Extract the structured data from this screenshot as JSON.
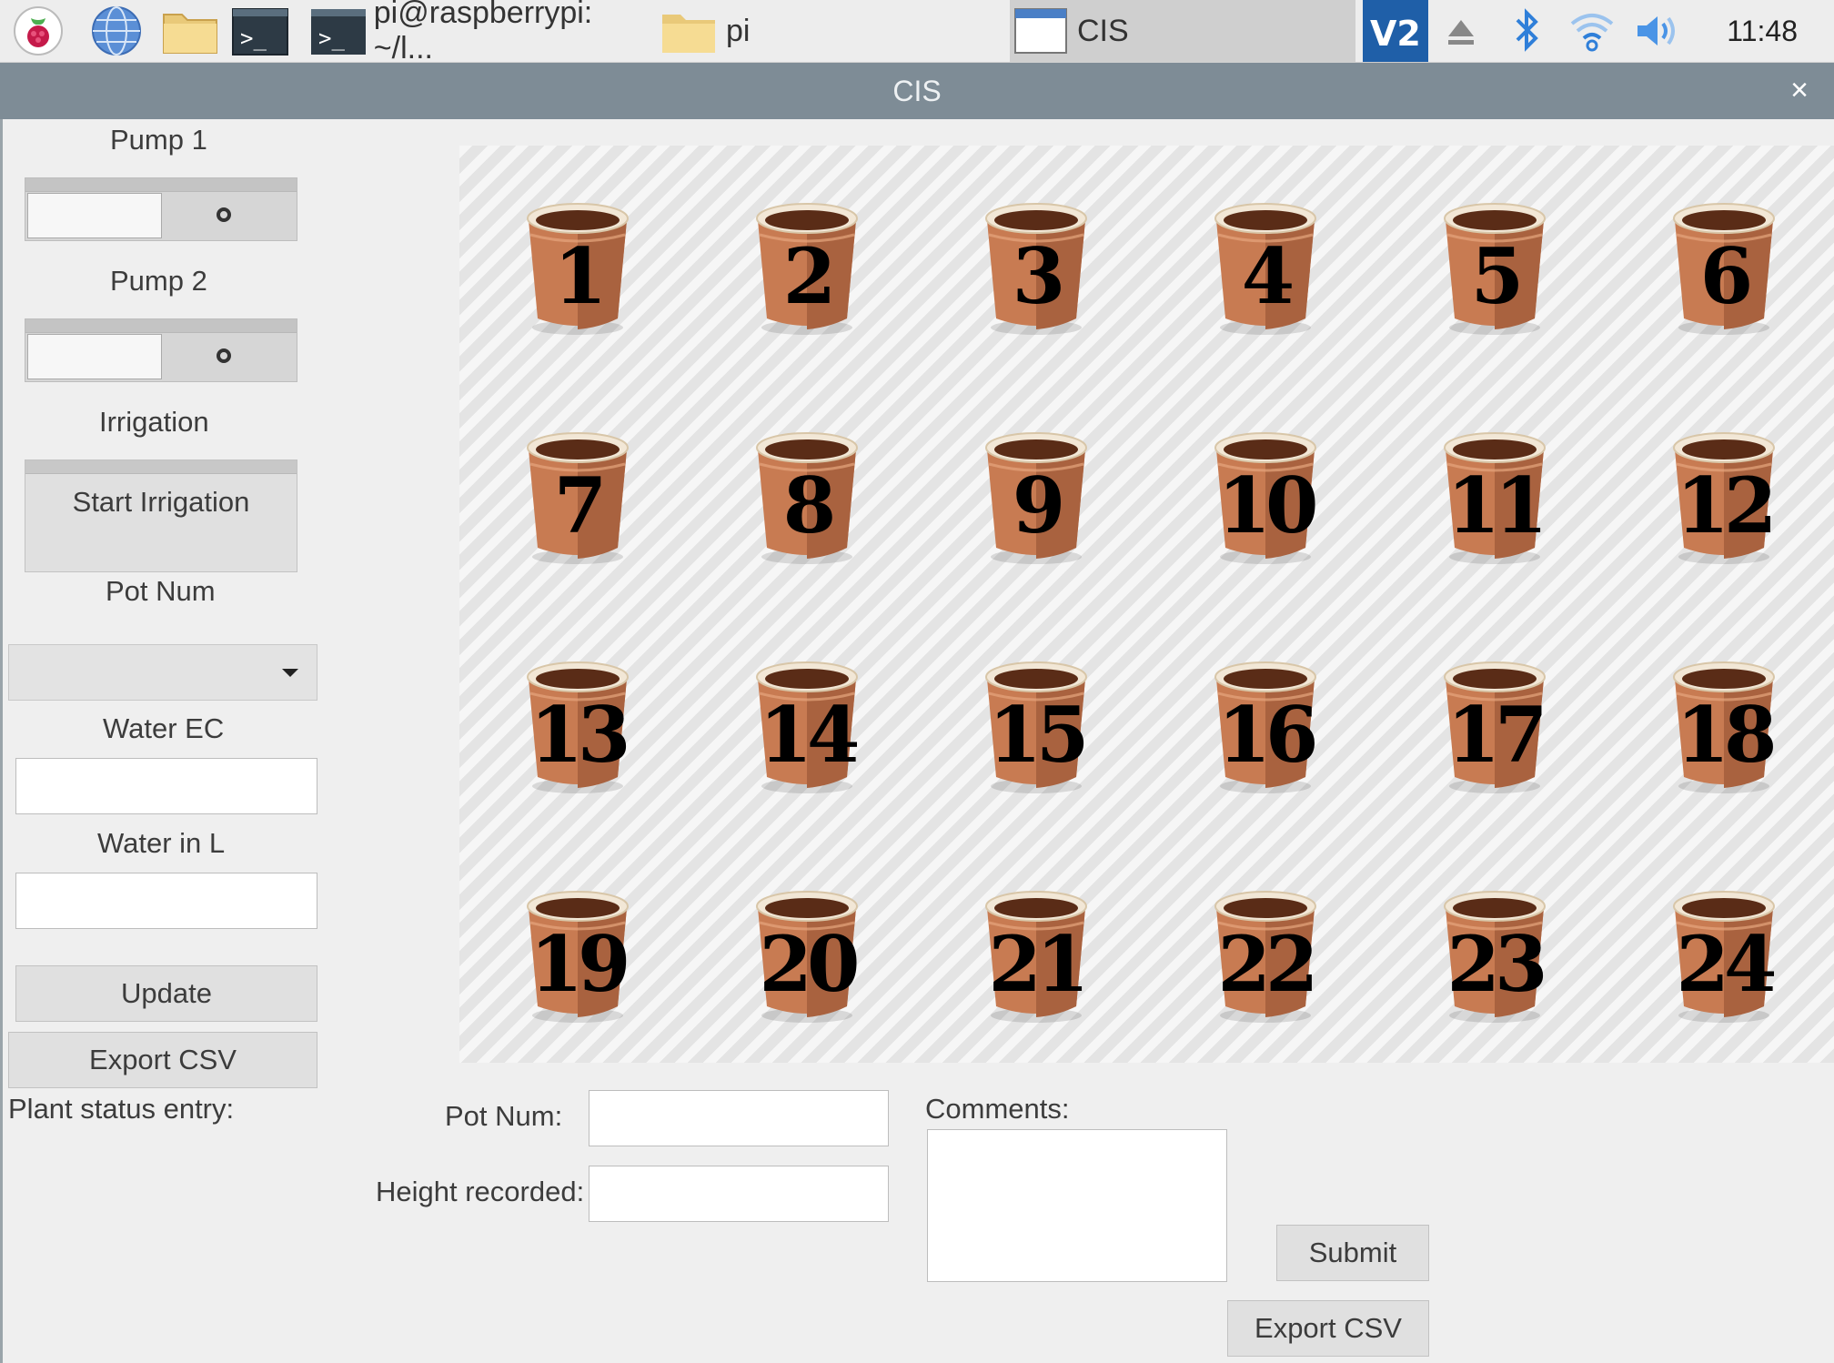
{
  "taskbar": {
    "launchers": [
      "raspberry-menu-icon",
      "web-browser-icon",
      "file-manager-icon",
      "terminal-icon"
    ],
    "tasks": [
      {
        "label": "pi@raspberrypi: ~/l...",
        "icon": "terminal-icon"
      },
      {
        "label": "pi",
        "icon": "folder-icon"
      },
      {
        "label": "CIS",
        "icon": "window-icon"
      }
    ],
    "tray": [
      "vnc-icon",
      "eject-icon",
      "bluetooth-icon",
      "wifi-icon",
      "volume-icon"
    ],
    "clock": "11:48"
  },
  "window": {
    "title": "CIS",
    "close_glyph": "×"
  },
  "sidebar": {
    "pump1_label": "Pump 1",
    "pump2_label": "Pump 2",
    "irrigation_label": "Irrigation",
    "start_irrigation": "Start Irrigation",
    "pot_num_label": "Pot Num",
    "pot_num_value": "",
    "water_ec_label": "Water EC",
    "water_ec_value": "",
    "water_l_label": "Water in L",
    "water_l_value": "",
    "update": "Update",
    "export_csv": "Export CSV",
    "plant_status_label": "Plant status entry:"
  },
  "pots": [
    "1",
    "2",
    "3",
    "4",
    "5",
    "6",
    "7",
    "8",
    "9",
    "10",
    "11",
    "12",
    "13",
    "14",
    "15",
    "16",
    "17",
    "18",
    "19",
    "20",
    "21",
    "22",
    "23",
    "24"
  ],
  "entry": {
    "pot_num_label": "Pot Num:",
    "pot_num_value": "",
    "height_label": "Height recorded:",
    "height_value": "",
    "comments_label": "Comments:",
    "comments_value": "",
    "submit": "Submit",
    "export_csv": "Export CSV"
  }
}
